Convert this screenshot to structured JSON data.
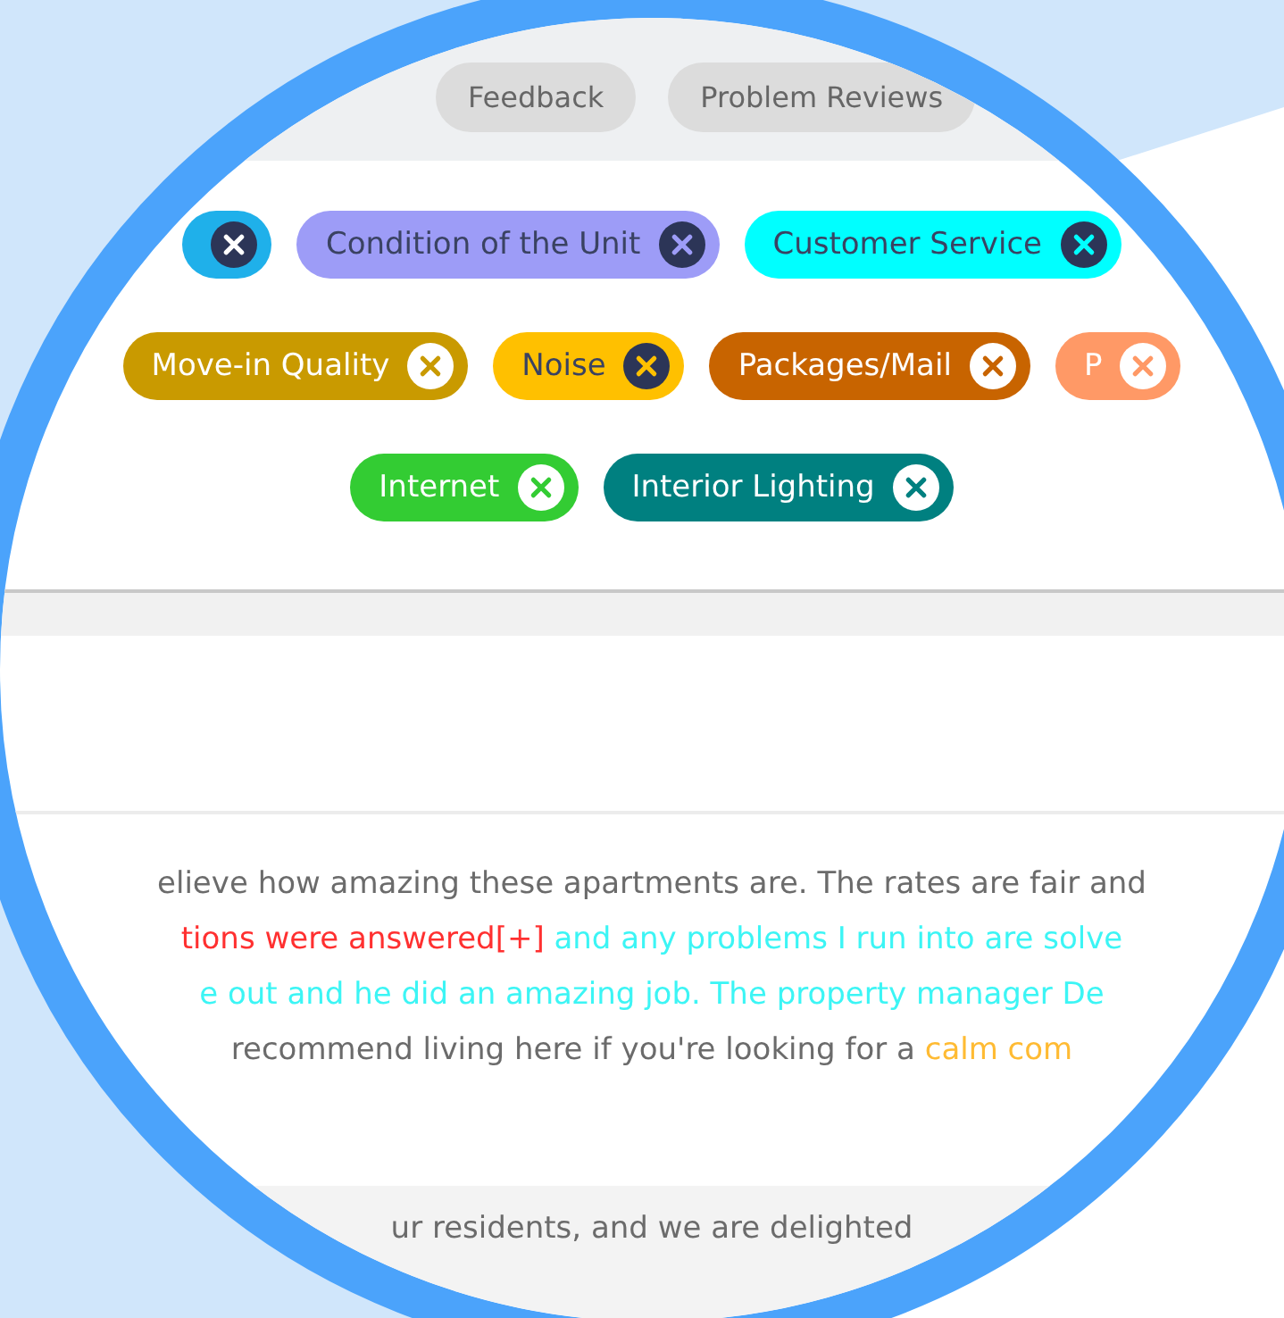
{
  "filter_tabs": [
    {
      "label": "Feedback"
    },
    {
      "label": "Problem Reviews"
    }
  ],
  "tag_rows": [
    [
      {
        "color": "#1fb0ea",
        "kind": "dark"
      },
      {
        "label": "Condition of the Unit",
        "color": "#9d9cf7",
        "kind": "dark"
      },
      {
        "label": "Customer Service",
        "color": "#00ffff",
        "kind": "dark"
      }
    ],
    [
      {
        "label": "Move-in Quality",
        "color": "#c99a00",
        "kind": "light"
      },
      {
        "label": "Noise",
        "color": "#ffc000",
        "kind": "dark"
      },
      {
        "label": "Packages/Mail",
        "color": "#c86400",
        "kind": "light"
      },
      {
        "label": "P",
        "color": "#ff9966",
        "kind": "light"
      }
    ],
    [
      {
        "label": "Internet",
        "color": "#33cc33",
        "kind": "light"
      },
      {
        "label": "Interior Lighting",
        "color": "#008080",
        "kind": "light"
      }
    ]
  ],
  "review_lines": [
    [
      {
        "text": "elieve how amazing these apartments are. The rates are fair and",
        "color": "#6b6b6b"
      }
    ],
    [
      {
        "text": "tions were answered[+]",
        "color": "#ff3030"
      },
      {
        "text": " and any problems I run into are solve",
        "color": "#3cf5f5"
      }
    ],
    [
      {
        "text": "e out and he did an amazing job. The property manager De",
        "color": "#3cf5f5"
      }
    ],
    [
      {
        "text": "recommend living here if you're looking for a ",
        "color": "#6b6b6b"
      },
      {
        "text": "calm com",
        "color": "#ffbb33"
      }
    ]
  ],
  "response": {
    "text": "ur residents, and we are delighted"
  }
}
